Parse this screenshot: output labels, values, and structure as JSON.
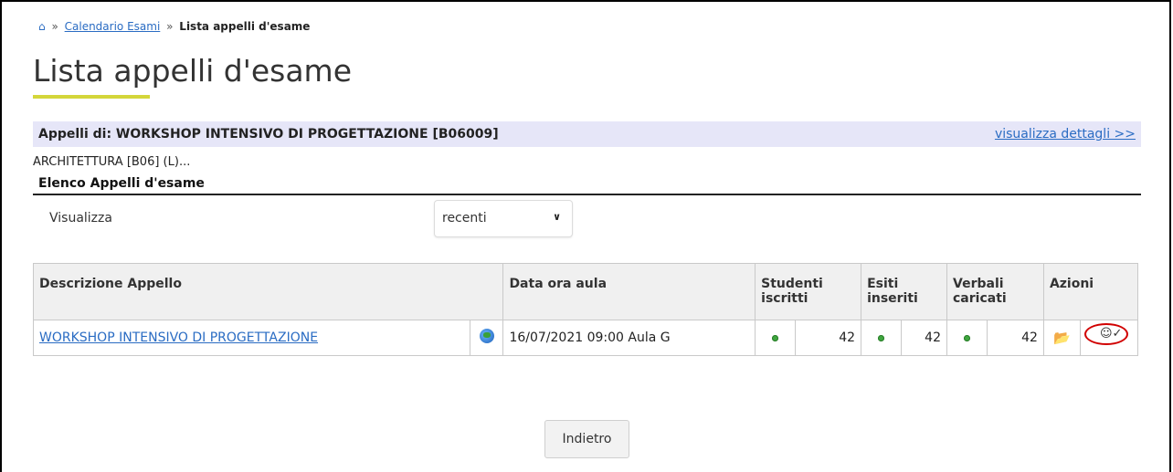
{
  "breadcrumb": {
    "home_icon": "home-icon",
    "sep1": "»",
    "link": "Calendario Esami",
    "sep2": "»",
    "current": "Lista appelli d'esame"
  },
  "page": {
    "title": "Lista appelli d'esame"
  },
  "appelli_header": {
    "title": "Appelli di: WORKSHOP INTENSIVO DI PROGETTAZIONE [B06009]",
    "details_link": "visualizza dettagli >>",
    "cds": "ARCHITETTURA [B06] (L)..."
  },
  "elenco": {
    "title": "Elenco Appelli d'esame",
    "visualizza_label": "Visualizza",
    "select_value": "recenti"
  },
  "table": {
    "headers": {
      "descrizione": "Descrizione Appello",
      "data": "Data ora aula",
      "studenti": "Studenti iscritti",
      "esiti": "Esiti inseriti",
      "verbali": "Verbali caricati",
      "azioni": "Azioni"
    },
    "rows": [
      {
        "descrizione": "WORKSHOP INTENSIVO DI PROGETTAZIONE",
        "data": "16/07/2021 09:00 Aula G",
        "studenti": "42",
        "esiti": "42",
        "verbali": "42"
      }
    ]
  },
  "footer": {
    "back_label": "Indietro"
  },
  "colors": {
    "accent_underline": "#d4d63a",
    "link": "#2a6cc3",
    "highlight_ring": "#d10000",
    "status_dot": "#3fa63f"
  }
}
